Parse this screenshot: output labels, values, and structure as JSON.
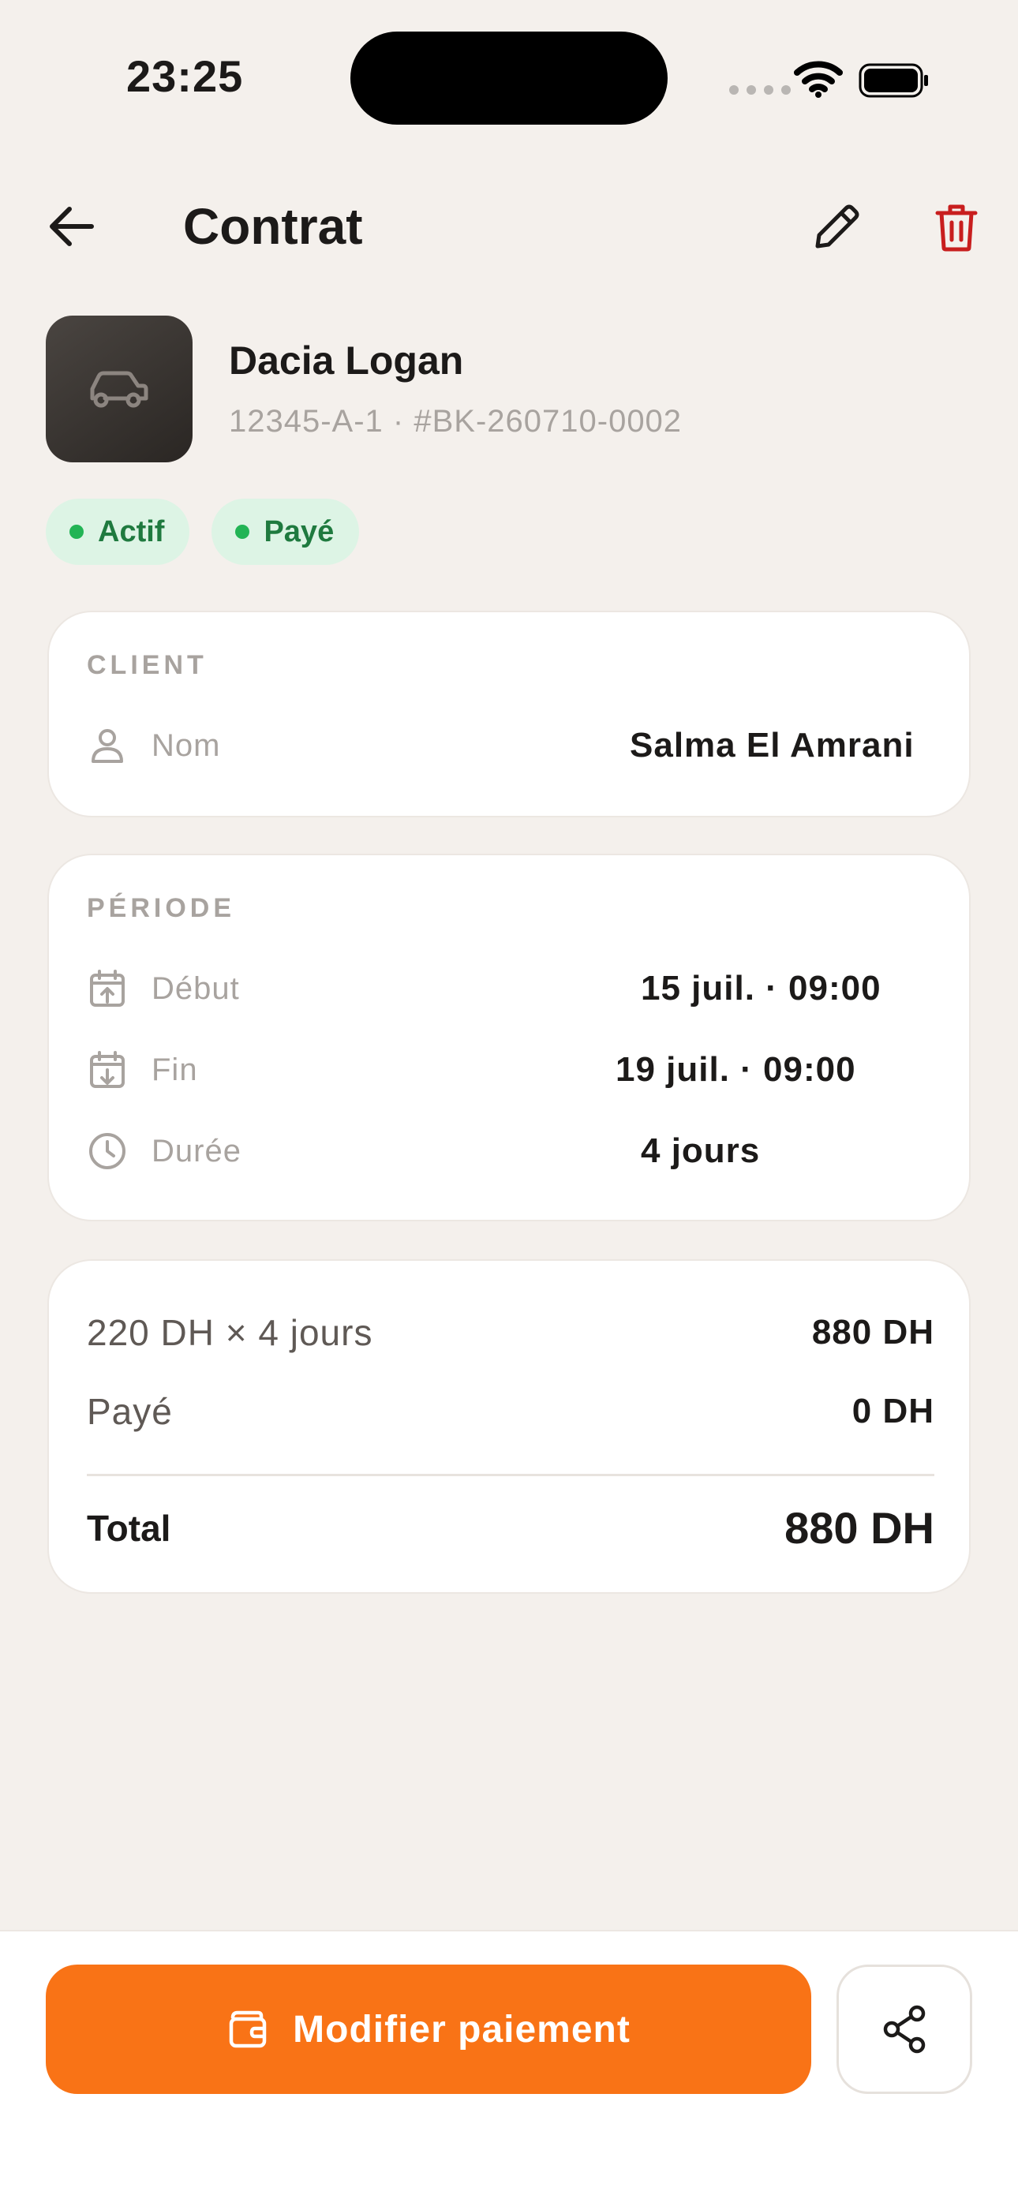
{
  "status_bar": {
    "time": "23:25"
  },
  "header": {
    "title": "Contrat"
  },
  "vehicle": {
    "name": "Dacia Logan",
    "reference": "12345-A-1 · #BK-260710-0002"
  },
  "badges": [
    {
      "label": "Actif",
      "color": "#22B455"
    },
    {
      "label": "Payé",
      "color": "#22B455"
    }
  ],
  "client": {
    "section_label": "CLIENT",
    "rows": [
      {
        "label": "Nom",
        "value": "Salma El Amrani",
        "icon": "user-icon"
      }
    ]
  },
  "period": {
    "section_label": "PÉRIODE",
    "rows": [
      {
        "label": "Début",
        "value": "15 juil. · 09:00",
        "icon": "calendar-start-icon"
      },
      {
        "label": "Fin",
        "value": "19 juil. · 09:00",
        "icon": "calendar-end-icon"
      },
      {
        "label": "Durée",
        "value": "4 jours",
        "icon": "clock-icon"
      }
    ]
  },
  "pricing": {
    "rate_label": "220 DH × 4 jours",
    "rate_value": "880 DH",
    "paid_label": "Payé",
    "paid_value": "0 DH",
    "total_label": "Total",
    "total_value": "880 DH"
  },
  "actions": {
    "primary_label": "Modifier paiement",
    "primary_icon": "wallet-icon",
    "share_icon": "share-icon"
  },
  "colors": {
    "accent": "#F97316",
    "danger": "#C81E1E",
    "success": "#22B455",
    "background": "#F4F0EC"
  }
}
